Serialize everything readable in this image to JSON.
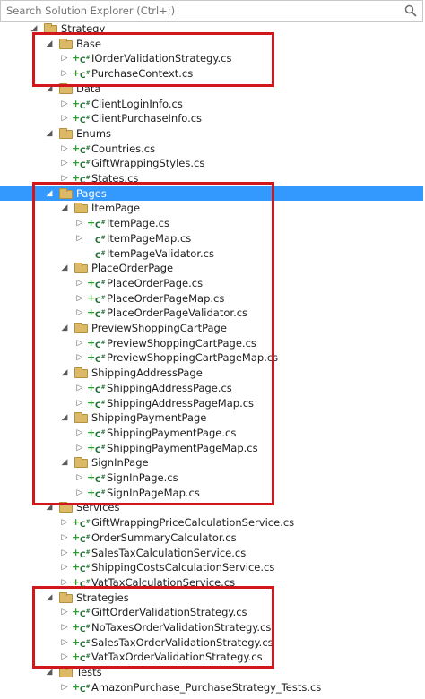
{
  "search": {
    "placeholder": "Search Solution Explorer (Ctrl+;)"
  },
  "tree": [
    {
      "label": "Strategy",
      "kind": "folder",
      "expanded": true,
      "depth": 0
    },
    {
      "label": "Base",
      "kind": "folder",
      "expanded": true,
      "depth": 1
    },
    {
      "label": "IOrderValidationStrategy.cs",
      "kind": "cs",
      "depth": 2
    },
    {
      "label": "PurchaseContext.cs",
      "kind": "cs",
      "depth": 2
    },
    {
      "label": "Data",
      "kind": "folder",
      "expanded": true,
      "depth": 1
    },
    {
      "label": "ClientLoginInfo.cs",
      "kind": "cs",
      "depth": 2
    },
    {
      "label": "ClientPurchaseInfo.cs",
      "kind": "cs",
      "depth": 2
    },
    {
      "label": "Enums",
      "kind": "folder",
      "expanded": true,
      "depth": 1
    },
    {
      "label": "Countries.cs",
      "kind": "cs",
      "depth": 2
    },
    {
      "label": "GiftWrappingStyles.cs",
      "kind": "cs",
      "depth": 2
    },
    {
      "label": "States.cs",
      "kind": "cs",
      "depth": 2
    },
    {
      "label": "Pages",
      "kind": "folder",
      "expanded": true,
      "depth": 1,
      "selected": true
    },
    {
      "label": "ItemPage",
      "kind": "folder",
      "expanded": true,
      "depth": 2
    },
    {
      "label": "ItemPage.cs",
      "kind": "cs",
      "depth": 3
    },
    {
      "label": "ItemPageMap.cs",
      "kind": "cs",
      "depth": 3,
      "noPlus": true
    },
    {
      "label": "ItemPageValidator.cs",
      "kind": "cs",
      "depth": 3,
      "noPlus": true,
      "noArrow": true
    },
    {
      "label": "PlaceOrderPage",
      "kind": "folder",
      "expanded": true,
      "depth": 2
    },
    {
      "label": "PlaceOrderPage.cs",
      "kind": "cs",
      "depth": 3
    },
    {
      "label": "PlaceOrderPageMap.cs",
      "kind": "cs",
      "depth": 3
    },
    {
      "label": "PlaceOrderPageValidator.cs",
      "kind": "cs",
      "depth": 3
    },
    {
      "label": "PreviewShoppingCartPage",
      "kind": "folder",
      "expanded": true,
      "depth": 2
    },
    {
      "label": "PreviewShoppingCartPage.cs",
      "kind": "cs",
      "depth": 3
    },
    {
      "label": "PreviewShoppingCartPageMap.cs",
      "kind": "cs",
      "depth": 3
    },
    {
      "label": "ShippingAddressPage",
      "kind": "folder",
      "expanded": true,
      "depth": 2
    },
    {
      "label": "ShippingAddressPage.cs",
      "kind": "cs",
      "depth": 3
    },
    {
      "label": "ShippingAddressPageMap.cs",
      "kind": "cs",
      "depth": 3
    },
    {
      "label": "ShippingPaymentPage",
      "kind": "folder",
      "expanded": true,
      "depth": 2
    },
    {
      "label": "ShippingPaymentPage.cs",
      "kind": "cs",
      "depth": 3
    },
    {
      "label": "ShippingPaymentPageMap.cs",
      "kind": "cs",
      "depth": 3
    },
    {
      "label": "SignInPage",
      "kind": "folder",
      "expanded": true,
      "depth": 2
    },
    {
      "label": "SignInPage.cs",
      "kind": "cs",
      "depth": 3
    },
    {
      "label": "SignInPageMap.cs",
      "kind": "cs",
      "depth": 3
    },
    {
      "label": "Services",
      "kind": "folder",
      "expanded": true,
      "depth": 1
    },
    {
      "label": "GiftWrappingPriceCalculationService.cs",
      "kind": "cs",
      "depth": 2
    },
    {
      "label": "OrderSummaryCalculator.cs",
      "kind": "cs",
      "depth": 2
    },
    {
      "label": "SalesTaxCalculationService.cs",
      "kind": "cs",
      "depth": 2
    },
    {
      "label": "ShippingCostsCalculationService.cs",
      "kind": "cs",
      "depth": 2
    },
    {
      "label": "VatTaxCalculationService.cs",
      "kind": "cs",
      "depth": 2
    },
    {
      "label": "Strategies",
      "kind": "folder",
      "expanded": true,
      "depth": 1
    },
    {
      "label": "GiftOrderValidationStrategy.cs",
      "kind": "cs",
      "depth": 2
    },
    {
      "label": "NoTaxesOrderValidationStrategy.cs",
      "kind": "cs",
      "depth": 2
    },
    {
      "label": "SalesTaxOrderValidationStrategy.cs",
      "kind": "cs",
      "depth": 2
    },
    {
      "label": "VatTaxOrderValidationStrategy.cs",
      "kind": "cs",
      "depth": 2
    },
    {
      "label": "Tests",
      "kind": "folder",
      "expanded": true,
      "depth": 1
    },
    {
      "label": "AmazonPurchase_PurchaseStrategy_Tests.cs",
      "kind": "cs",
      "depth": 2
    }
  ],
  "icons": {
    "expanded": "triangle-down-icon",
    "collapsed": "triangle-right-icon",
    "folder": "folder-icon",
    "csharp": "csharp-file-icon",
    "add": "plus-icon"
  },
  "colors": {
    "selection": "#3399ff",
    "highlight_box": "#d2171c",
    "folder": "#dcb967",
    "csharp": "#1b6b2e",
    "plus": "#2f9a2f"
  },
  "highlight_boxes": [
    {
      "name": "base-highlight",
      "from": "Base",
      "to": "PurchaseContext.cs"
    },
    {
      "name": "pages-highlight",
      "from": "Pages",
      "to": "SignInPageMap.cs"
    },
    {
      "name": "strategies-highlight",
      "from": "Strategies",
      "to": "VatTaxOrderValidationStrategy.cs"
    }
  ]
}
